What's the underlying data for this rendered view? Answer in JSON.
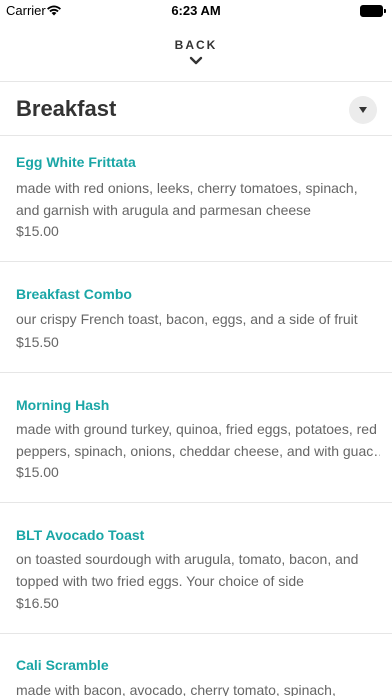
{
  "status_bar": {
    "carrier": "Carrier",
    "time": "6:23 AM",
    "icons": [
      "wifi-icon",
      "battery-icon"
    ]
  },
  "nav": {
    "back_label": "BACK",
    "back_icon": "chevron-down-icon"
  },
  "section": {
    "title": "Breakfast",
    "toggle_icon": "caret-down-icon"
  },
  "colors": {
    "accent": "#1aa6a6",
    "text_primary": "#333333",
    "text_secondary": "#666666",
    "divider": "#e6e6e6",
    "toggle_bg": "#ececec"
  },
  "menu_items": [
    {
      "name": "Egg White Frittata",
      "description_lines": [
        "made with red onions, leeks, cherry tomatoes, spinach,",
        "and garnish with arugula and parmesan cheese"
      ],
      "price": "$15.00"
    },
    {
      "name": "Breakfast Combo",
      "description_lines": [
        "our crispy French toast, bacon, eggs, and a side of fruit"
      ],
      "price": "$15.50"
    },
    {
      "name": "Morning Hash",
      "description_lines": [
        "made with ground turkey, quinoa, fried eggs, potatoes, red",
        "peppers, spinach, onions, cheddar cheese, and with guac…"
      ],
      "price": "$15.00"
    },
    {
      "name": "BLT Avocado Toast",
      "description_lines": [
        "on toasted sourdough with arugula, tomato, bacon, and",
        "topped with two fried eggs. Your choice of side"
      ],
      "price": "$16.50"
    },
    {
      "name": "Cali Scramble",
      "description_lines": [
        "made with bacon, avocado, cherry tomato, spinach,"
      ],
      "price": ""
    }
  ]
}
